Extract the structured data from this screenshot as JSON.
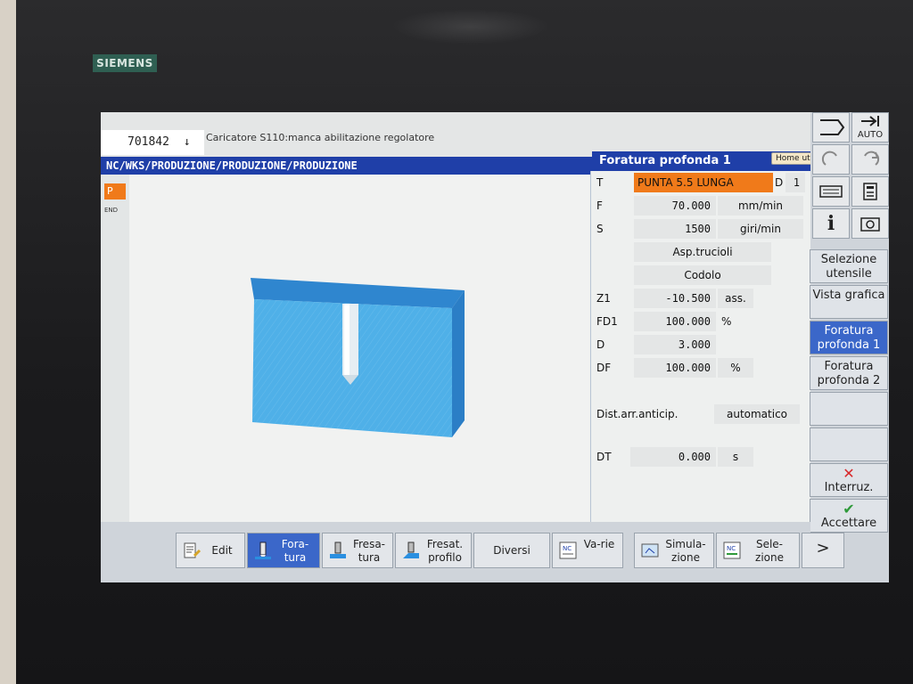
{
  "brand": "SIEMENS",
  "header": {
    "program_number": "701842",
    "program_arrow": "↓",
    "alarm_text": "Caricatore S110:manca abilitazione regolatore"
  },
  "path": "NC/WKS/PRODUZIONE/PRODUZIONE/PRODUZIONE",
  "cycle_title": "Foratura profonda 1",
  "home_badge": "Home utensile",
  "editor": {
    "p_label": "P",
    "end_label": "END"
  },
  "form": {
    "t_label": "T",
    "tool_name": "PUNTA 5.5 LUNGA",
    "d_label": "D",
    "d_value": "1",
    "f_label": "F",
    "f_value": "70.000",
    "f_unit": "mm/min",
    "s_label": "S",
    "s_value": "1500",
    "s_unit": "giri/min",
    "chip_mode": "Asp.trucioli",
    "shank": "Codolo",
    "z1_label": "Z1",
    "z1_value": "-10.500",
    "z1_unit": "ass.",
    "fd1_label": "FD1",
    "fd1_value": "100.000",
    "fd1_unit": "%",
    "d2_label": "D",
    "d2_value": "3.000",
    "df_label": "DF",
    "df_value": "100.000",
    "df_unit": "%",
    "dist_label": "Dist.arr.anticip.",
    "dist_value": "automatico",
    "dt_label": "DT",
    "dt_value": "0.000",
    "dt_unit": "s"
  },
  "right_icons": {
    "auto_label": "AUTO",
    "info_label": "i"
  },
  "vertical_softkeys": [
    {
      "label": "Selezione utensile"
    },
    {
      "label": "Vista grafica"
    },
    {
      "label": "Foratura profonda 1"
    },
    {
      "label": "Foratura profonda 2"
    },
    {
      "label": "Interruz."
    },
    {
      "label": "Accettare"
    }
  ],
  "horizontal_softkeys": [
    {
      "label": "Edit"
    },
    {
      "label": "Fora-tura"
    },
    {
      "label": "Fresa-tura"
    },
    {
      "label": "Fresat. profilo"
    },
    {
      "label": "Diversi"
    },
    {
      "label": "Va-rie"
    },
    {
      "label": "Simula-zione"
    },
    {
      "label": "Sele-zione"
    },
    {
      "label": ">"
    }
  ],
  "colors": {
    "accent_blue": "#1f3fa8",
    "active_softkey": "#3b67c9",
    "tool_orange": "#f07a1a",
    "workpiece_blue": "#5fb6e8"
  }
}
